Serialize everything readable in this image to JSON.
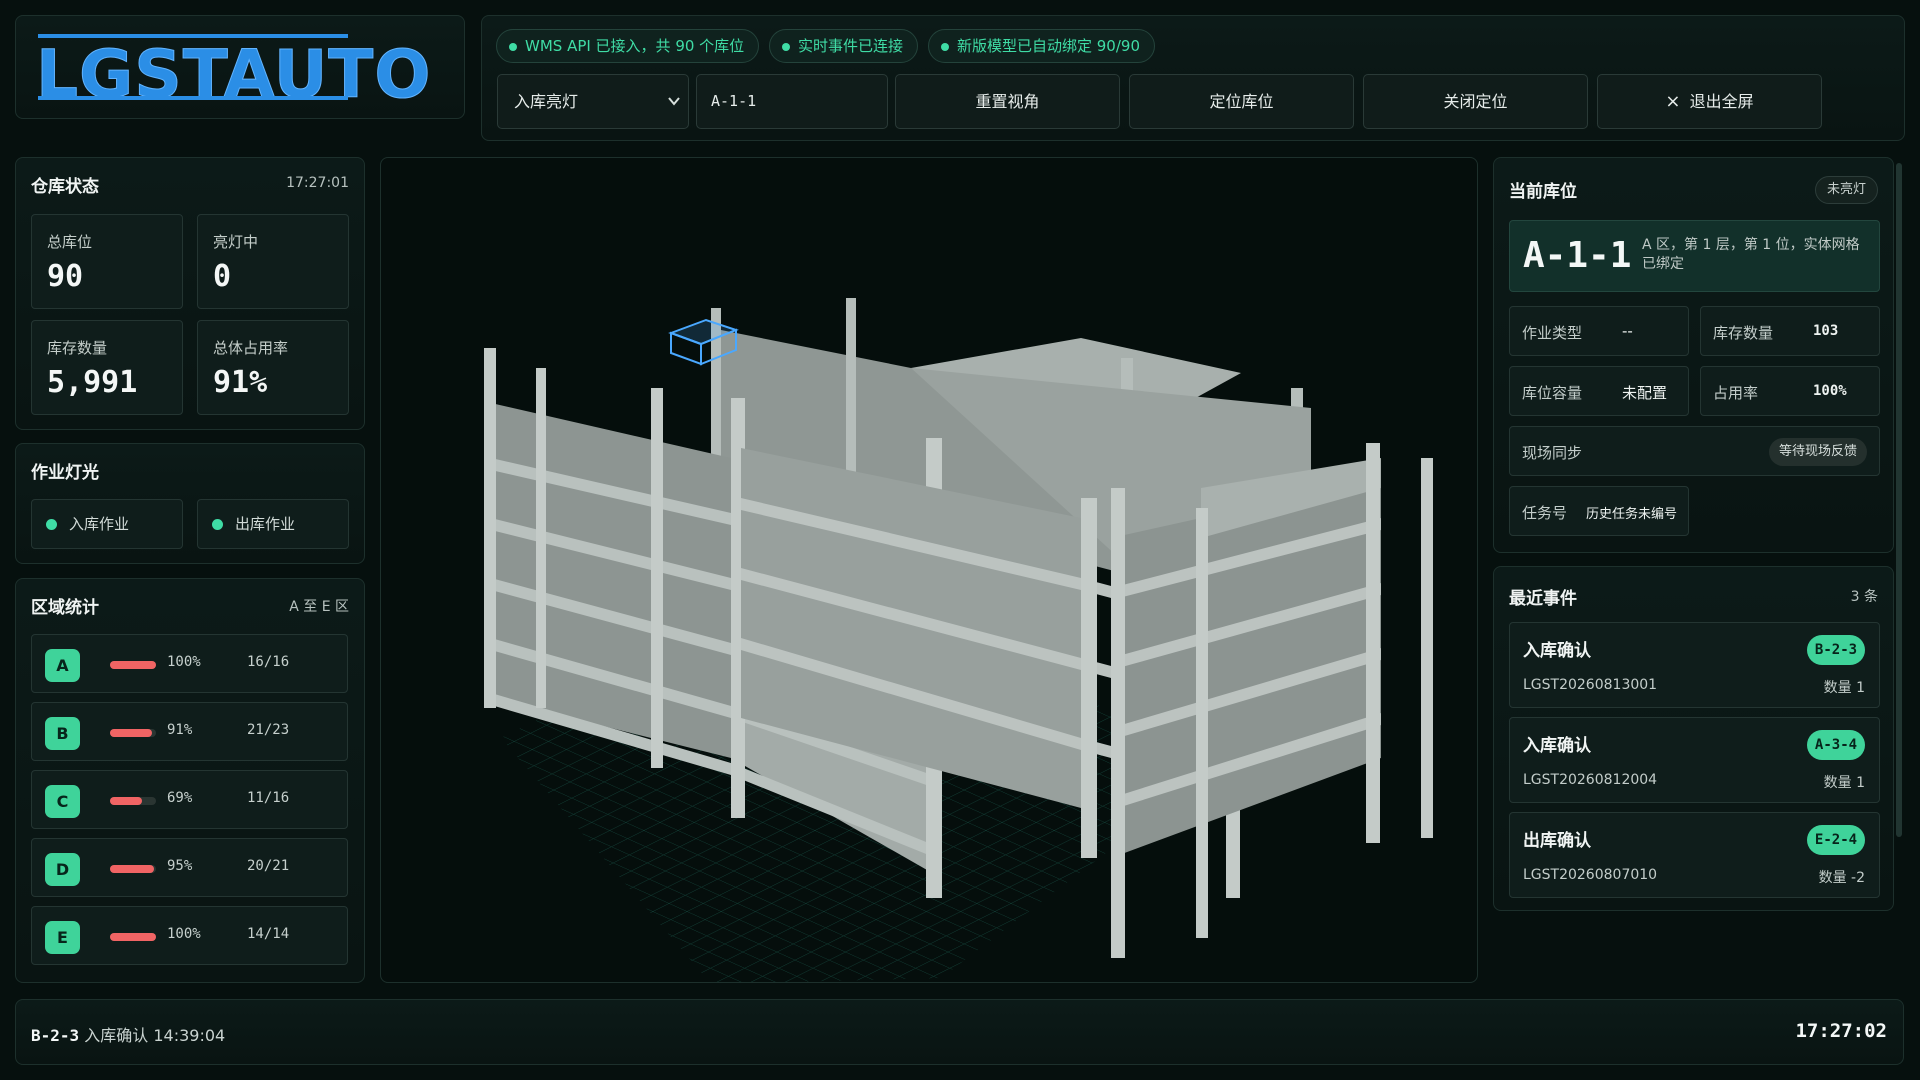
{
  "logo": {
    "text": "LGSTAUTO"
  },
  "toolbar": {
    "chips": [
      "WMS API 已接入，共 90 个库位",
      "实时事件已连接",
      "新版模型已自动绑定 90/90"
    ],
    "mode_select": "入库亮灯",
    "location_input": "A-1-1",
    "buttons": {
      "reset_view": "重置视角",
      "locate": "定位库位",
      "close_locate": "关闭定位",
      "exit_fullscreen": "退出全屏"
    },
    "close_glyph": "×"
  },
  "warehouse": {
    "title": "仓库状态",
    "time": "17:27:01",
    "stats": [
      {
        "label": "总库位",
        "value": "90"
      },
      {
        "label": "亮灯中",
        "value": "0"
      },
      {
        "label": "库存数量",
        "value": "5,991"
      },
      {
        "label": "总体占用率",
        "value": "91%"
      }
    ]
  },
  "lights": {
    "title": "作业灯光",
    "items": [
      "入库作业",
      "出库作业"
    ],
    "color": "#3fdca5"
  },
  "zones": {
    "title": "区域统计",
    "range": "A 至 E 区",
    "rows": [
      {
        "zone": "A",
        "pct": "100%",
        "fill": 1.0,
        "count": "16/16"
      },
      {
        "zone": "B",
        "pct": "91%",
        "fill": 0.91,
        "count": "21/23"
      },
      {
        "zone": "C",
        "pct": "69%",
        "fill": 0.69,
        "count": "11/16"
      },
      {
        "zone": "D",
        "pct": "95%",
        "fill": 0.95,
        "count": "20/21"
      },
      {
        "zone": "E",
        "pct": "100%",
        "fill": 1.0,
        "count": "14/14"
      }
    ]
  },
  "current": {
    "title": "当前库位",
    "status": "未亮灯",
    "code": "A-1-1",
    "desc": "A 区，第 1 层，第 1 位，实体网格已绑定",
    "fields": {
      "job_type": {
        "label": "作业类型",
        "value": "--"
      },
      "stock_qty": {
        "label": "库存数量",
        "value": "103"
      },
      "capacity": {
        "label": "库位容量",
        "value": "未配置"
      },
      "occupancy": {
        "label": "占用率",
        "value": "100%"
      },
      "sync": {
        "label": "现场同步",
        "value": "等待现场反馈"
      },
      "task": {
        "label": "任务号",
        "value": "历史任务未编号"
      }
    }
  },
  "events": {
    "title": "最近事件",
    "count": "3 条",
    "items": [
      {
        "title": "入库确认",
        "tag": "B-2-3",
        "order": "LGST20260813001",
        "qty": "数量 1"
      },
      {
        "title": "入库确认",
        "tag": "A-3-4",
        "order": "LGST20260812004",
        "qty": "数量 1"
      },
      {
        "title": "出库确认",
        "tag": "E-2-4",
        "order": "LGST20260807010",
        "qty": "数量 -2"
      }
    ]
  },
  "footer": {
    "last_code": "B-2-3",
    "last_text": "入库确认 14:39:04",
    "clock": "17:27:02"
  },
  "colors": {
    "accent": "#3fdca5",
    "zone_bar": "#f06464",
    "logo": "#2b8ee6",
    "highlight_box": "#4aa8ff"
  }
}
